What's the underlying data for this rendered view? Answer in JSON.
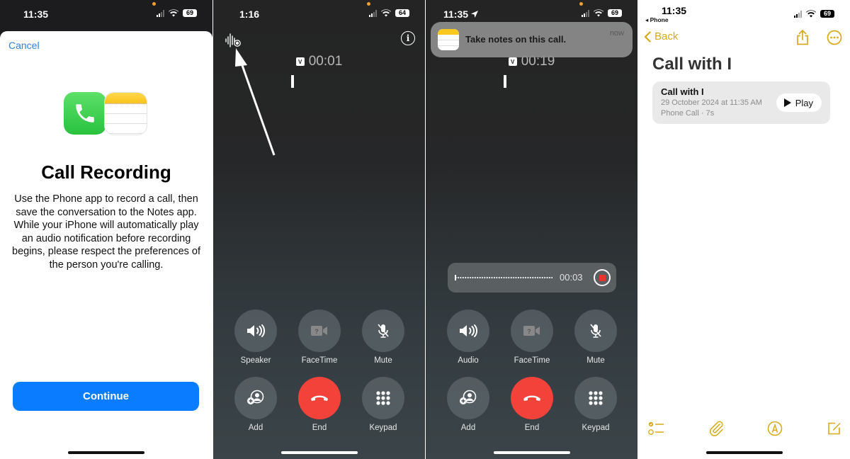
{
  "colors": {
    "ios_blue": "#0a7cff",
    "end_red": "#f2423a",
    "notes_yellow": "#d6aa1c",
    "record_red": "#e8352c"
  },
  "panel1": {
    "status": {
      "time": "11:35",
      "battery": "69"
    },
    "cancel_label": "Cancel",
    "icons": [
      "phone-app-icon",
      "notes-app-icon"
    ],
    "title": "Call Recording",
    "body": "Use the Phone app to record a call, then save the conversation to the Notes app. While your iPhone will automatically play an audio notification before recording begins, please respect the preferences of the person you're calling.",
    "continue_label": "Continue"
  },
  "panel2": {
    "status": {
      "time": "1:16",
      "battery": "64"
    },
    "record_icon": "waveform-record-icon",
    "info_icon": "info-icon",
    "timer_badge": "V",
    "timer": "00:01",
    "controls": [
      {
        "label": "Speaker",
        "icon": "speaker-icon"
      },
      {
        "label": "FaceTime",
        "icon": "facetime-icon"
      },
      {
        "label": "Mute",
        "icon": "mute-icon"
      },
      {
        "label": "Add",
        "icon": "add-person-icon"
      },
      {
        "label": "End",
        "icon": "end-call-icon"
      },
      {
        "label": "Keypad",
        "icon": "keypad-icon"
      }
    ]
  },
  "panel3": {
    "status": {
      "time": "11:35",
      "battery": "69"
    },
    "notification": {
      "message": "Take notes on this call.",
      "time": "now",
      "app_icon": "notes-app-icon"
    },
    "timer_badge": "V",
    "timer": "00:19",
    "recording": {
      "elapsed": "00:03",
      "stop_icon": "stop-record-icon"
    },
    "controls": [
      {
        "label": "Audio",
        "icon": "speaker-icon"
      },
      {
        "label": "FaceTime",
        "icon": "facetime-icon"
      },
      {
        "label": "Mute",
        "icon": "mute-icon"
      },
      {
        "label": "Add",
        "icon": "add-person-icon"
      },
      {
        "label": "End",
        "icon": "end-call-icon"
      },
      {
        "label": "Keypad",
        "icon": "keypad-icon"
      }
    ]
  },
  "panel4": {
    "status": {
      "time": "11:35",
      "battery": "69",
      "back_app": "◂ Phone"
    },
    "back_label": "Back",
    "title": "Call with I",
    "attachment": {
      "title": "Call with I",
      "date": "29 October 2024 at 11:35 AM",
      "meta": "Phone Call · 7s",
      "play_label": "Play"
    },
    "toolbar": [
      "checklist-icon",
      "paperclip-icon",
      "markup-icon",
      "compose-icon"
    ]
  }
}
